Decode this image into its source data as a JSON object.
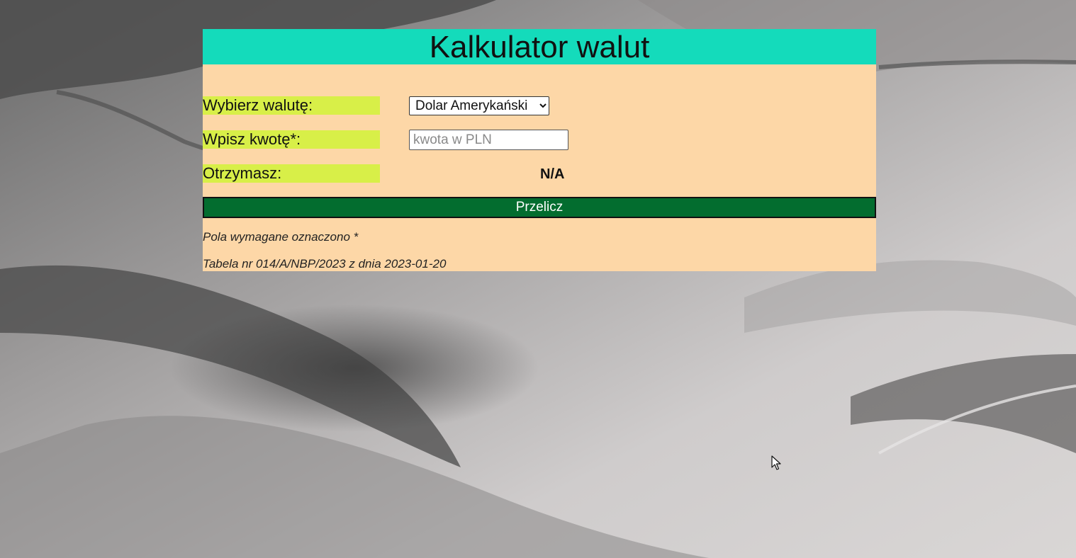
{
  "page": {
    "title": "Kalkulator walut"
  },
  "form": {
    "currency_label": "Wybierz walutę:",
    "currency_selected": "Dolar Amerykański",
    "currency_options": [
      "Dolar Amerykański"
    ],
    "amount_label": "Wpisz kwotę*:",
    "amount_value": "",
    "amount_placeholder": "kwota w PLN",
    "result_label": "Otrzymasz:",
    "result_value": "N/A",
    "submit_label": "Przelicz"
  },
  "footer": {
    "required_note": "Pola wymagane oznaczono *",
    "table_info": "Tabela nr 014/A/NBP/2023 z dnia 2023-01-20"
  },
  "colors": {
    "header_bg": "#14dbbb",
    "panel_bg": "#fdd7a7",
    "label_bg": "#d8ef48",
    "button_bg": "#036d2f"
  },
  "icons": {
    "cursor": "mouse-pointer-icon",
    "dropdown": "chevron-down-icon"
  }
}
